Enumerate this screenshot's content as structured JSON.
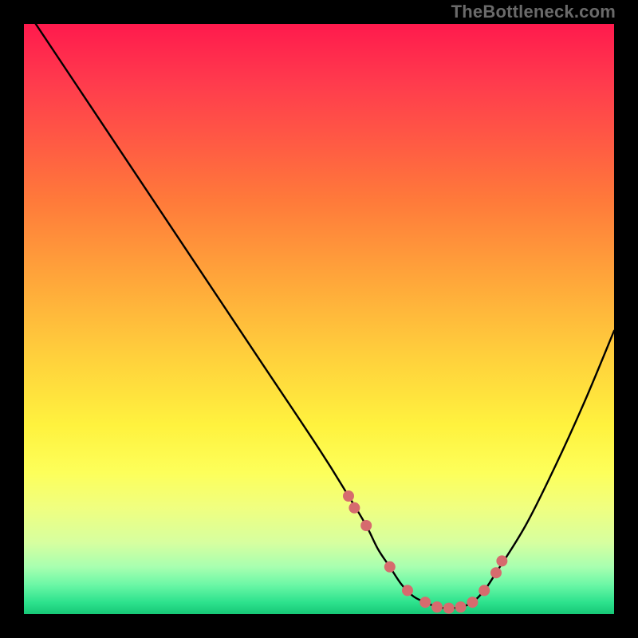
{
  "watermark": "TheBottleneck.com",
  "chart_data": {
    "type": "line",
    "title": "",
    "xlabel": "",
    "ylabel": "",
    "xlim": [
      0,
      100
    ],
    "ylim": [
      0,
      100
    ],
    "grid": false,
    "legend": false,
    "series": [
      {
        "name": "bottleneck-curve",
        "x": [
          2,
          10,
          20,
          30,
          40,
          50,
          55,
          58,
          60,
          62,
          64,
          66,
          68,
          70,
          72,
          74,
          76,
          78,
          80,
          85,
          90,
          95,
          100
        ],
        "values": [
          100,
          88,
          73,
          58,
          43,
          28,
          20,
          15,
          11,
          8,
          5,
          3,
          2,
          1.2,
          1,
          1.2,
          2,
          4,
          7,
          15,
          25,
          36,
          48
        ]
      }
    ],
    "markers": {
      "name": "highlight-points",
      "color": "#d66b6e",
      "x": [
        55,
        56,
        58,
        62,
        65,
        68,
        70,
        72,
        74,
        76,
        78,
        80,
        81
      ],
      "values": [
        20,
        18,
        15,
        8,
        4,
        2,
        1.2,
        1,
        1.2,
        2,
        4,
        7,
        9
      ]
    }
  }
}
